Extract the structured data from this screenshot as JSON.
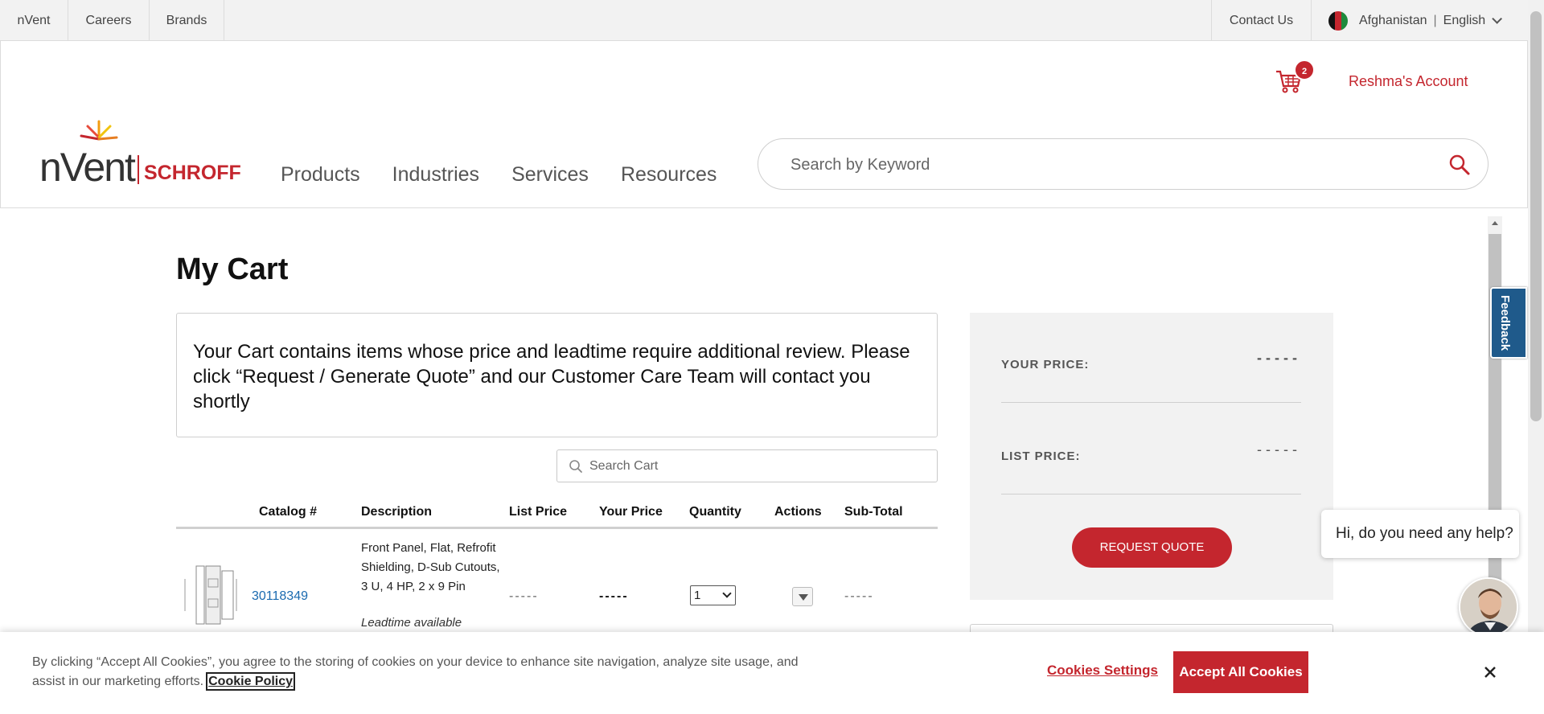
{
  "topbar": {
    "links": {
      "nvent": "nVent",
      "careers": "Careers",
      "brands": "Brands",
      "contact": "Contact Us"
    },
    "country": "Afghanistan",
    "separator": "|",
    "language": "English"
  },
  "header": {
    "cart_count": "2",
    "account": "Reshma's Account",
    "logo": {
      "brand": "nVent",
      "sub": "SCHROFF"
    },
    "nav": [
      "Products",
      "Industries",
      "Services",
      "Resources"
    ],
    "search_placeholder": "Search by Keyword"
  },
  "main": {
    "title": "My Cart",
    "notice": "Your Cart contains items whose price and leadtime require additional review. Please click “Request / Generate Quote” and our Customer Care Team will contact you shortly",
    "cart_search_placeholder": "Search Cart",
    "columns": [
      "Catalog #",
      "Description",
      "List Price",
      "Your Price",
      "Quantity",
      "Actions",
      "Sub-Total"
    ],
    "rows": [
      {
        "catalog": "30118349",
        "description": "Front Panel, Flat, Refrofit Shielding, D-Sub Cutouts, 3 U, 4 HP, 2 x 9 Pin",
        "leadtime": "Leadtime available",
        "list_price": "-----",
        "your_price": "-----",
        "quantity": "1",
        "subtotal": "-----"
      }
    ]
  },
  "summary": {
    "your_price_label": "YOUR PRICE:",
    "your_price_value": "-----",
    "list_price_label": "LIST PRICE:",
    "list_price_value": "-----",
    "button": "REQUEST QUOTE"
  },
  "feedback": "Feedback",
  "chat": {
    "message": "Hi, do you need any help?"
  },
  "cookie": {
    "text": "By clicking “Accept All Cookies”, you agree to the storing of cookies on your device to enhance site navigation, analyze site usage, and assist in our marketing efforts.",
    "policy_link": "Cookie Policy",
    "settings": "Cookies Settings",
    "accept": "Accept All Cookies"
  },
  "colors": {
    "brand_red": "#c4262e",
    "link_blue": "#1a6ab0",
    "feedback_blue": "#1f5a8b"
  }
}
